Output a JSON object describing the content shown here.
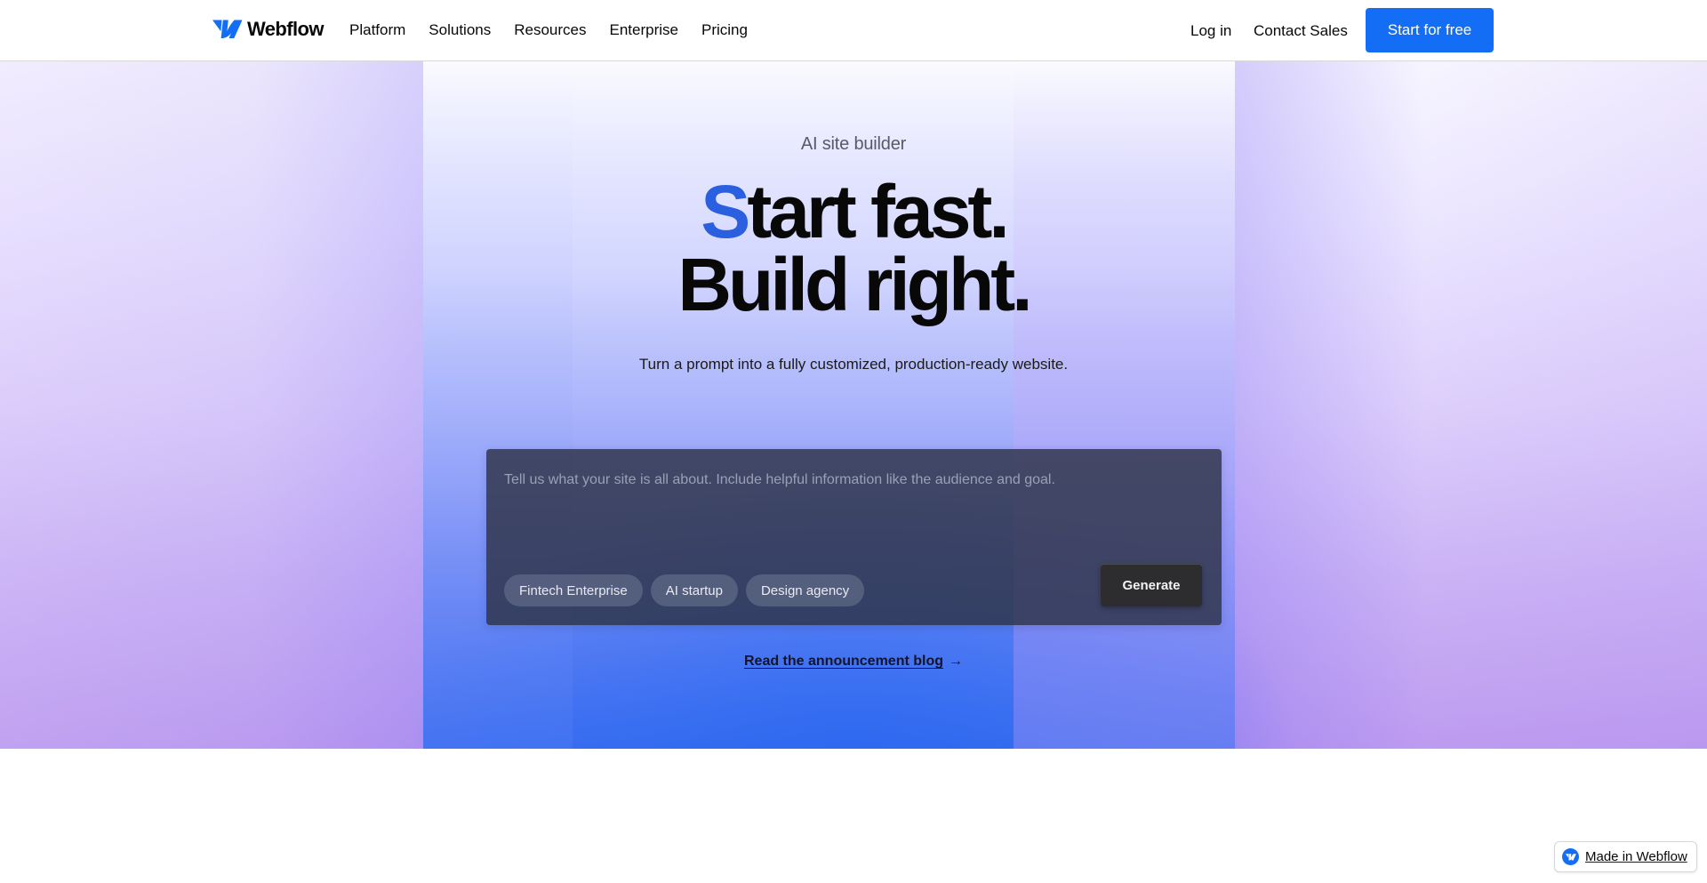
{
  "nav": {
    "brand": "Webflow",
    "links": [
      "Platform",
      "Solutions",
      "Resources",
      "Enterprise",
      "Pricing"
    ],
    "login": "Log in",
    "contact": "Contact Sales",
    "cta": "Start for free"
  },
  "hero": {
    "eyebrow": "AI site builder",
    "headline_accent": "S",
    "headline_line1_rest": "tart fast.",
    "headline_line2": "Build right.",
    "subhead": "Turn a prompt into a fully customized, production-ready website.",
    "prompt_placeholder": "Tell us what your site is all about. Include helpful information like the audience and goal.",
    "prompt_value": "",
    "chips": [
      "Fintech Enterprise",
      "AI startup",
      "Design agency"
    ],
    "generate_label": "Generate",
    "blog_link": "Read the announcement blog",
    "blog_arrow": "→"
  },
  "badge": {
    "label": "Made in Webflow"
  },
  "colors": {
    "brand_blue": "#146ef5",
    "headline_accent": "#2a5fe0",
    "text": "#080808"
  }
}
